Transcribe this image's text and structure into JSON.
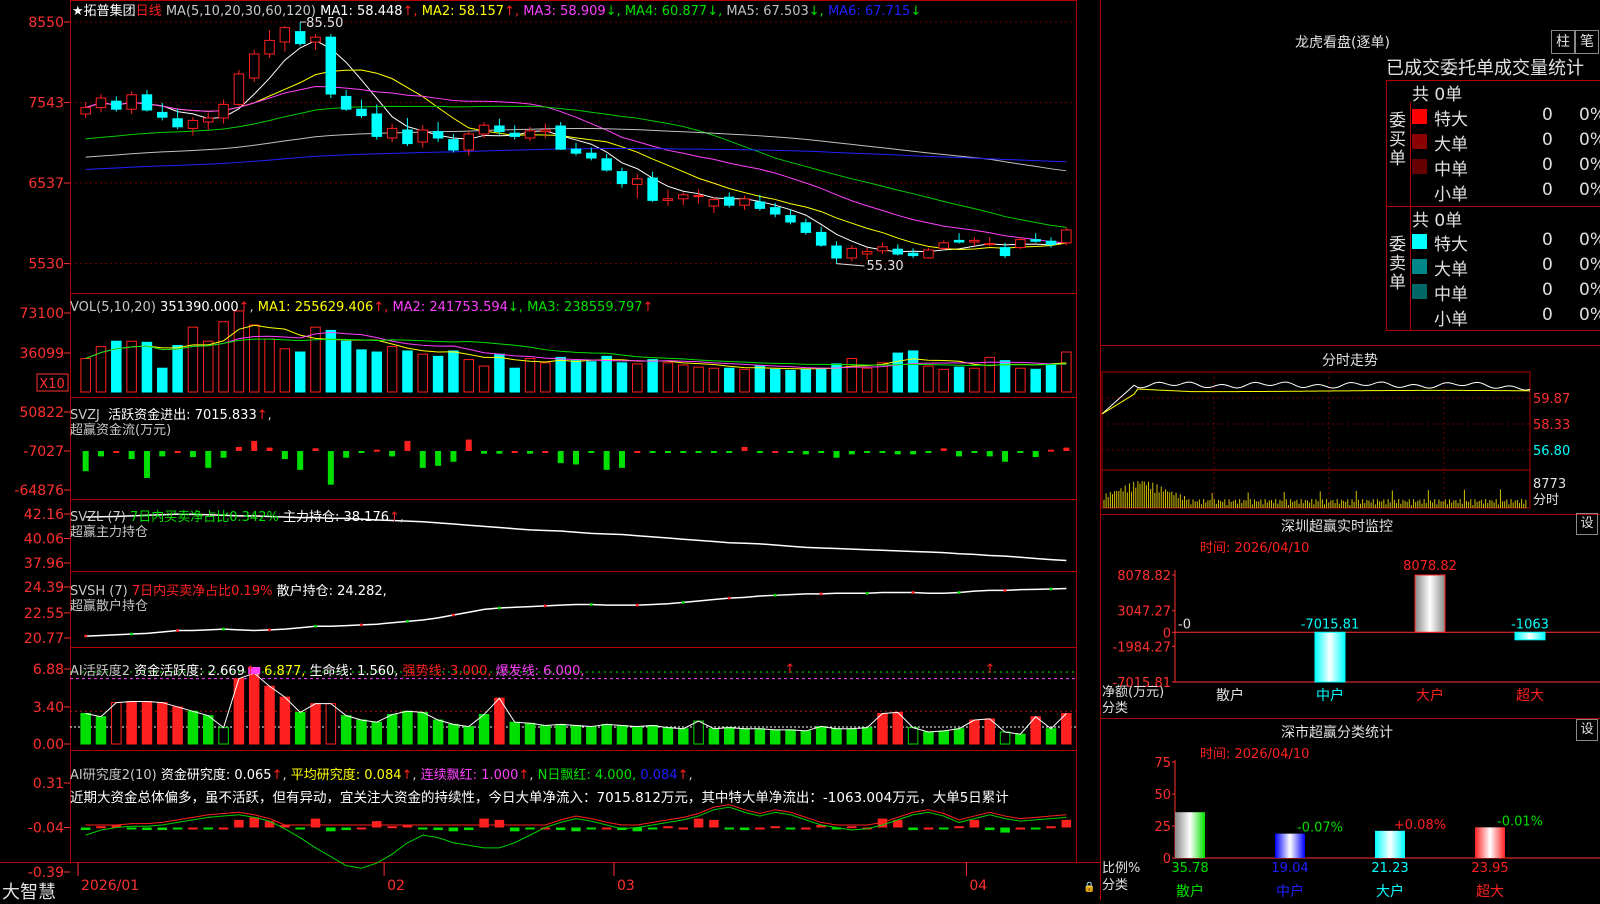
{
  "app": {
    "brand": "大智慧"
  },
  "colors": {
    "up": "#ff2020",
    "down": "#00ffff",
    "green": "#00e000",
    "grid": "#8b0000",
    "white": "#ffffff",
    "yellow": "#ffff00",
    "magenta": "#ff40ff",
    "ma_green": "#00cc00",
    "blue": "#2020ff",
    "gray": "#c0c0c0",
    "frame": "#b00000"
  },
  "icons": {
    "star": "star-icon",
    "lock": "lock-icon",
    "arrow": "up-arrow-icon"
  },
  "main": {
    "star": "★",
    "stock_name": "拓普集团",
    "period": "日线",
    "ma_label": "MA(5,10,20,30,60,120)",
    "ma_values": [
      {
        "label": "MA1:",
        "value": "58.448",
        "arrow": "↑",
        "color": "#ffffff"
      },
      {
        "label": "MA2:",
        "value": "58.157",
        "arrow": "↑",
        "color": "#ffff00"
      },
      {
        "label": "MA3:",
        "value": "58.909",
        "arrow": "↓",
        "color": "#ff40ff"
      },
      {
        "label": "MA4:",
        "value": "60.877",
        "arrow": "↓",
        "color": "#00e000"
      },
      {
        "label": "MA5:",
        "value": "67.503",
        "arrow": "↓",
        "color": "#c0c0c0"
      },
      {
        "label": "MA6:",
        "value": "67.715",
        "arrow": "↓",
        "color": "#2020ff"
      }
    ],
    "y_ticks": [
      "8550",
      "7543",
      "6537",
      "5530"
    ],
    "high_label": "85.50",
    "low_label": "55.30"
  },
  "vol": {
    "label": "VOL(5,10,20)",
    "value": "351390.000",
    "items": [
      {
        "label": "MA1:",
        "value": "255629.406",
        "arrow": "↑",
        "color": "#ffff00"
      },
      {
        "label": "MA2:",
        "value": "241753.594",
        "arrow": "↓",
        "color": "#ff40ff"
      },
      {
        "label": "MA3:",
        "value": "238559.797",
        "arrow": "↑",
        "color": "#00e000"
      }
    ],
    "y_ticks": [
      "73100",
      "36099"
    ],
    "unit": "X10"
  },
  "svzj": {
    "label": "SVZJ",
    "title": "活跃资金进出:",
    "value": "7015.833",
    "subtitle": "超赢资金流(万元)",
    "y_ticks": [
      "50822",
      "-7027",
      "-64876"
    ]
  },
  "svzl": {
    "label": "SVZL (7)",
    "title": "7日内买卖净占比0.342%",
    "extra": "主力持仓:",
    "extra_value": "38.176",
    "subtitle": "超赢主力持仓",
    "y_ticks": [
      "42.16",
      "40.06",
      "37.96"
    ]
  },
  "svsh": {
    "label": "SVSH (7)",
    "title": "7日内买卖净占比0.19%",
    "extra": "散户持仓:",
    "extra_value": "24.282,",
    "subtitle": "超赢散户持仓",
    "y_ticks": [
      "24.39",
      "22.55",
      "20.77"
    ]
  },
  "ai_active": {
    "label": "AI活跃度2",
    "title": "资金活跃度:",
    "value": "2.669",
    "v2": "6.877,",
    "life": "生命线:",
    "life_value": "1.560,",
    "strong": "强势线:",
    "strong_value": "3.000,",
    "burst": "爆发线:",
    "burst_value": "6.000,",
    "y_ticks": [
      "6.88",
      "3.40",
      "0.00"
    ]
  },
  "ai_research": {
    "label": "AI研究度2(10)",
    "title": "资金研究度:",
    "value": "0.065",
    "avg": "平均研究度:",
    "avg_value": "0.084",
    "red": "连续飘红:",
    "red_value": "1.000",
    "nred": "N日飘红:",
    "nred_value": "4.000,",
    "last": "0.084",
    "comment": "近期大资金总体偏多，虽不活跃，但有异动，宜关注大资金的持续性，今日大单净流入：7015.812万元，其中特大单净流出：-1063.004万元，大单5日累计",
    "y_ticks": [
      "0.31",
      "-0.04",
      "-0.39"
    ]
  },
  "x_axis": [
    "2026/01",
    "02",
    "03",
    "04"
  ],
  "right": {
    "dragon_title": "龙虎看盘(逐单)",
    "btn_col": "柱",
    "btn_brush": "笔",
    "stats_title": "已成交委托单成交量统计",
    "buy_side": "委买单",
    "sell_side": "委卖单",
    "buy_total": "共 0单",
    "sell_total": "共 0单",
    "buy_rows": [
      {
        "label": "特大",
        "count": "0",
        "pct": "0%",
        "color": "#ff0000"
      },
      {
        "label": "大单",
        "count": "0",
        "pct": "0%",
        "color": "#8b0000"
      },
      {
        "label": "中单",
        "count": "0",
        "pct": "0%",
        "color": "#660000"
      },
      {
        "label": "小单",
        "count": "0",
        "pct": "0%",
        "color": ""
      }
    ],
    "sell_rows": [
      {
        "label": "特大",
        "count": "0",
        "pct": "0%",
        "color": "#00ffff"
      },
      {
        "label": "大单",
        "count": "0",
        "pct": "0%",
        "color": "#008888"
      },
      {
        "label": "中单",
        "count": "0",
        "pct": "0%",
        "color": "#006666"
      },
      {
        "label": "小单",
        "count": "0",
        "pct": "0%",
        "color": ""
      }
    ],
    "intraday_title": "分时走势",
    "intraday_ticks": [
      "59.87",
      "58.33",
      "56.80"
    ],
    "intraday_vol_tick": "8773",
    "intraday_vol_unit": "分时",
    "sz_title": "深圳超赢实时监控",
    "sz_set": "设",
    "sz_time": "时间: 2026/04/10",
    "sz_ticks": [
      "8078.82",
      "3047.27",
      "0",
      "-1984.27",
      "-7015.81"
    ],
    "sz_zero": "-0",
    "sz_unit": "净额(万元)",
    "sz_class": "分类",
    "sz_bars": [
      {
        "cat": "散户",
        "value": -0.0,
        "label": ""
      },
      {
        "cat": "中户",
        "value": -7015.81,
        "label": "-7015.81"
      },
      {
        "cat": "大户",
        "value": 8078.82,
        "label": "8078.82"
      },
      {
        "cat": "超大",
        "value": -1063,
        "label": "-1063"
      }
    ],
    "cls_title": "深市超赢分类统计",
    "cls_set": "设",
    "cls_time": "时间: 2026/04/10",
    "cls_ticks": [
      "75",
      "50",
      "25",
      "0"
    ],
    "cls_unit": "比例%",
    "cls_class": "分类",
    "cls_bars": [
      {
        "cat": "散户",
        "value": 35.78,
        "label": "35.78",
        "delta": ""
      },
      {
        "cat": "中户",
        "value": 19.04,
        "label": "19.04",
        "delta": "-0.07%"
      },
      {
        "cat": "大户",
        "value": 21.23,
        "label": "21.23",
        "delta": "+0.08%"
      },
      {
        "cat": "超大",
        "value": 23.95,
        "label": "23.95",
        "delta": "-0.01%"
      }
    ]
  },
  "chart_data": [
    {
      "type": "candlestick",
      "title": "拓普集团 日线",
      "ylim": [
        53,
        87
      ],
      "y_ticks": [
        85.5,
        75.43,
        65.37,
        55.3
      ],
      "candles": [
        [
          74.0,
          75.5,
          73.5,
          74.8
        ],
        [
          74.8,
          76.5,
          74.2,
          76.0
        ],
        [
          75.6,
          76.2,
          74.3,
          74.6
        ],
        [
          74.6,
          76.8,
          74.0,
          76.4
        ],
        [
          76.4,
          77.0,
          74.3,
          74.5
        ],
        [
          74.2,
          75.4,
          73.2,
          73.6
        ],
        [
          73.4,
          74.6,
          72.1,
          72.4
        ],
        [
          72.2,
          73.6,
          71.3,
          73.2
        ],
        [
          73.0,
          74.2,
          72.0,
          73.5
        ],
        [
          73.5,
          75.8,
          72.8,
          75.2
        ],
        [
          75.2,
          79.5,
          75.0,
          79.0
        ],
        [
          78.5,
          82.0,
          78.0,
          81.5
        ],
        [
          81.5,
          84.5,
          81.0,
          83.2
        ],
        [
          83.0,
          85.0,
          81.8,
          84.8
        ],
        [
          84.3,
          85.5,
          82.5,
          82.8
        ],
        [
          83.0,
          84.0,
          82.0,
          83.6
        ],
        [
          83.6,
          84.0,
          76.0,
          76.5
        ],
        [
          76.2,
          77.0,
          74.4,
          74.6
        ],
        [
          74.6,
          75.8,
          73.5,
          73.8
        ],
        [
          74.0,
          75.2,
          70.8,
          71.2
        ],
        [
          71.0,
          72.8,
          70.5,
          72.2
        ],
        [
          72.0,
          73.5,
          70.0,
          70.3
        ],
        [
          70.5,
          72.6,
          69.8,
          72.0
        ],
        [
          71.8,
          73.0,
          70.5,
          71.0
        ],
        [
          70.8,
          71.5,
          69.2,
          69.5
        ],
        [
          69.5,
          71.8,
          68.8,
          71.5
        ],
        [
          71.5,
          73.0,
          71.0,
          72.6
        ],
        [
          72.5,
          73.4,
          71.4,
          71.8
        ],
        [
          71.6,
          72.6,
          70.8,
          71.2
        ],
        [
          71.0,
          72.4,
          70.6,
          71.9
        ],
        [
          71.8,
          72.8,
          71.0,
          72.0
        ],
        [
          72.5,
          73.0,
          69.5,
          69.6
        ],
        [
          69.6,
          70.4,
          68.8,
          69.1
        ],
        [
          69.1,
          69.8,
          68.2,
          68.5
        ],
        [
          68.4,
          69.0,
          66.8,
          67.0
        ],
        [
          66.8,
          67.3,
          64.8,
          65.3
        ],
        [
          65.2,
          66.5,
          63.5,
          65.9
        ],
        [
          66.0,
          66.8,
          63.0,
          63.2
        ],
        [
          63.2,
          64.5,
          62.5,
          63.4
        ],
        [
          63.4,
          64.2,
          62.6,
          63.9
        ],
        [
          63.8,
          64.6,
          62.8,
          63.8
        ],
        [
          62.5,
          63.6,
          61.6,
          63.3
        ],
        [
          63.6,
          64.2,
          62.3,
          62.6
        ],
        [
          62.6,
          63.8,
          62.0,
          63.4
        ],
        [
          63.0,
          63.9,
          61.9,
          62.2
        ],
        [
          62.3,
          62.9,
          61.1,
          61.5
        ],
        [
          61.3,
          62.1,
          60.2,
          60.5
        ],
        [
          60.4,
          60.9,
          58.9,
          59.2
        ],
        [
          59.2,
          59.9,
          57.4,
          57.6
        ],
        [
          57.5,
          58.1,
          55.3,
          56.0
        ],
        [
          56.0,
          57.6,
          55.6,
          57.2
        ],
        [
          56.5,
          57.3,
          55.8,
          56.8
        ],
        [
          56.9,
          57.9,
          56.5,
          57.4
        ],
        [
          57.1,
          57.7,
          56.3,
          56.5
        ],
        [
          56.6,
          57.2,
          56.0,
          56.3
        ],
        [
          56.0,
          57.3,
          55.9,
          57.0
        ],
        [
          57.2,
          58.2,
          57.0,
          57.9
        ],
        [
          58.2,
          59.1,
          57.8,
          58.0
        ],
        [
          58.0,
          58.6,
          57.5,
          58.2
        ],
        [
          57.7,
          58.6,
          57.5,
          57.8
        ],
        [
          57.3,
          57.9,
          56.0,
          56.3
        ],
        [
          57.3,
          58.6,
          57.1,
          58.3
        ],
        [
          58.3,
          59.1,
          57.9,
          58.1
        ],
        [
          58.1,
          58.6,
          57.3,
          57.7
        ],
        [
          57.9,
          59.8,
          57.6,
          59.5
        ]
      ]
    },
    {
      "type": "bar",
      "title": "VOL(5,10,20)",
      "ylim": [
        0,
        73100
      ],
      "y_ticks": [
        73100,
        36099
      ],
      "values": [
        31000,
        42000,
        47000,
        47000,
        46000,
        22000,
        43000,
        60000,
        47000,
        65000,
        75000,
        62000,
        49000,
        40000,
        37000,
        60000,
        57000,
        47000,
        39000,
        37000,
        42000,
        38000,
        35000,
        33000,
        38000,
        30000,
        24000,
        35000,
        22000,
        31000,
        27000,
        32000,
        29000,
        28000,
        33000,
        27000,
        26000,
        30000,
        27000,
        25000,
        23000,
        22000,
        22000,
        21000,
        24000,
        21000,
        20000,
        21000,
        22000,
        26000,
        31000,
        22000,
        27000,
        36000,
        38000,
        24000,
        21000,
        23000,
        22000,
        32000,
        29000,
        22000,
        21000,
        26000,
        37000
      ]
    },
    {
      "type": "bar",
      "title": "超赢资金流(万元)",
      "ylim": [
        -64876,
        50822
      ],
      "y_ticks": [
        50822,
        -7027,
        -64876
      ],
      "values": [
        -30000,
        -8000,
        0,
        -12000,
        -40000,
        -8000,
        0,
        -9000,
        -25000,
        -10000,
        6000,
        15000,
        5000,
        -12000,
        -28000,
        4000,
        -50000,
        -10000,
        -2000,
        2000,
        -8000,
        15000,
        -25000,
        -22000,
        -16000,
        17000,
        -4000,
        -4000,
        0,
        -4000,
        0,
        -18000,
        -20000,
        -2000,
        -28000,
        -25000,
        0,
        -2000,
        -2000,
        -2000,
        -2000,
        -2000,
        -3000,
        6000,
        -2000,
        0,
        -3000,
        -5000,
        -3000,
        -10000,
        -5000,
        -2000,
        -2000,
        -5000,
        -5000,
        -3000,
        4000,
        -8000,
        -2000,
        -8000,
        -16000,
        -2000,
        -9000,
        2000,
        5000
      ]
    },
    {
      "type": "line",
      "title": "超赢主力持仓",
      "ylim": [
        37.96,
        42.16
      ],
      "y_ticks": [
        42.16,
        40.06,
        37.96
      ],
      "values": [
        41.9,
        41.92,
        41.95,
        42.0,
        42.05,
        42.1,
        42.15,
        42.13,
        42.1,
        42.05,
        42.0,
        42.0,
        41.95,
        41.9,
        41.85,
        41.85,
        41.8,
        41.78,
        41.72,
        41.65,
        41.6,
        41.55,
        41.5,
        41.4,
        41.3,
        41.2,
        41.1,
        41.0,
        40.9,
        40.8,
        40.75,
        40.7,
        40.6,
        40.5,
        40.45,
        40.4,
        40.3,
        40.2,
        40.1,
        40.0,
        39.9,
        39.8,
        39.7,
        39.65,
        39.6,
        39.5,
        39.4,
        39.3,
        39.25,
        39.2,
        39.15,
        39.1,
        39.05,
        39.0,
        38.95,
        38.9,
        38.85,
        38.75,
        38.7,
        38.6,
        38.55,
        38.45,
        38.35,
        38.25,
        38.176
      ]
    },
    {
      "type": "line",
      "title": "超赢散户持仓",
      "ylim": [
        20.77,
        24.39
      ],
      "y_ticks": [
        24.39,
        22.55,
        20.77
      ],
      "values": [
        20.9,
        20.95,
        21.0,
        21.05,
        21.1,
        21.2,
        21.3,
        21.3,
        21.35,
        21.4,
        21.35,
        21.3,
        21.35,
        21.4,
        21.5,
        21.6,
        21.6,
        21.65,
        21.7,
        21.75,
        21.85,
        21.95,
        22.05,
        22.2,
        22.4,
        22.6,
        22.8,
        22.9,
        22.95,
        23.0,
        23.05,
        23.1,
        23.15,
        23.15,
        23.1,
        23.1,
        23.1,
        23.15,
        23.2,
        23.3,
        23.4,
        23.5,
        23.6,
        23.65,
        23.75,
        23.8,
        23.85,
        23.9,
        23.9,
        23.95,
        23.95,
        23.95,
        24.0,
        24.0,
        24.0,
        23.95,
        23.95,
        24.0,
        24.1,
        24.15,
        24.15,
        24.2,
        24.22,
        24.25,
        24.282
      ]
    },
    {
      "type": "bar",
      "title": "资金活跃度",
      "ylim": [
        0,
        6.88
      ],
      "y_ticks": [
        6.88,
        3.4,
        0.0
      ],
      "values": [
        2.8,
        2.5,
        3.8,
        3.9,
        3.9,
        3.8,
        3.4,
        3.0,
        2.6,
        1.5,
        6.0,
        6.5,
        5.3,
        4.3,
        2.9,
        3.7,
        3.7,
        2.6,
        2.2,
        2.0,
        2.7,
        3.0,
        2.9,
        2.2,
        1.8,
        1.6,
        2.7,
        4.2,
        2.0,
        1.9,
        1.7,
        1.8,
        1.7,
        1.6,
        1.8,
        1.7,
        1.6,
        1.7,
        1.5,
        1.4,
        2.1,
        1.4,
        1.5,
        1.4,
        1.4,
        1.3,
        1.3,
        1.2,
        1.6,
        1.4,
        1.4,
        1.5,
        2.8,
        2.9,
        1.5,
        1.1,
        1.2,
        1.4,
        2.2,
        2.3,
        1.1,
        0.9,
        2.5,
        1.4,
        2.8
      ],
      "lines": {
        "生命线": 1.56,
        "强势线": 3.0,
        "爆发线": 6.0
      }
    },
    {
      "type": "bar",
      "title": "资金研究度",
      "ylim": [
        -0.39,
        0.31
      ],
      "y_ticks": [
        0.31,
        -0.04,
        -0.39
      ],
      "values": [
        -0.06,
        -0.03,
        -0.02,
        -0.05,
        -0.06,
        -0.06,
        -0.05,
        -0.04,
        -0.05,
        -0.04,
        0.02,
        0.04,
        0.01,
        -0.02,
        -0.05,
        0.03,
        -0.07,
        -0.06,
        -0.04,
        0.01,
        -0.03,
        -0.02,
        -0.05,
        -0.06,
        -0.07,
        -0.06,
        0.03,
        0.02,
        -0.07,
        -0.05,
        -0.04,
        -0.06,
        -0.07,
        -0.05,
        -0.04,
        -0.06,
        -0.07,
        -0.05,
        -0.03,
        -0.04,
        0.03,
        0.02,
        -0.05,
        -0.06,
        -0.04,
        -0.03,
        -0.05,
        -0.04,
        -0.02,
        -0.05,
        -0.03,
        -0.04,
        0.03,
        0.02,
        -0.06,
        -0.04,
        -0.05,
        -0.03,
        0.02,
        -0.06,
        -0.08,
        -0.04,
        -0.05,
        -0.03,
        0.02
      ],
      "line": [
        -0.1,
        -0.06,
        -0.04,
        -0.03,
        -0.03,
        -0.02,
        0.0,
        0.02,
        0.04,
        0.05,
        0.06,
        0.04,
        0.01,
        -0.05,
        -0.12,
        -0.2,
        -0.27,
        -0.34,
        -0.36,
        -0.32,
        -0.25,
        -0.16,
        -0.1,
        -0.12,
        -0.16,
        -0.18,
        -0.2,
        -0.2,
        -0.16,
        -0.1,
        -0.04,
        0.0,
        0.03,
        0.01,
        -0.02,
        -0.05,
        -0.04,
        -0.02,
        0.0,
        0.02,
        0.05,
        0.1,
        0.12,
        0.08,
        0.05,
        0.08,
        0.06,
        0.02,
        -0.02,
        -0.04,
        -0.06,
        -0.05,
        -0.02,
        0.02,
        0.06,
        0.08,
        0.05,
        0.0,
        0.03,
        0.06,
        0.03,
        0.01,
        0.02,
        0.03,
        0.04
      ]
    }
  ]
}
